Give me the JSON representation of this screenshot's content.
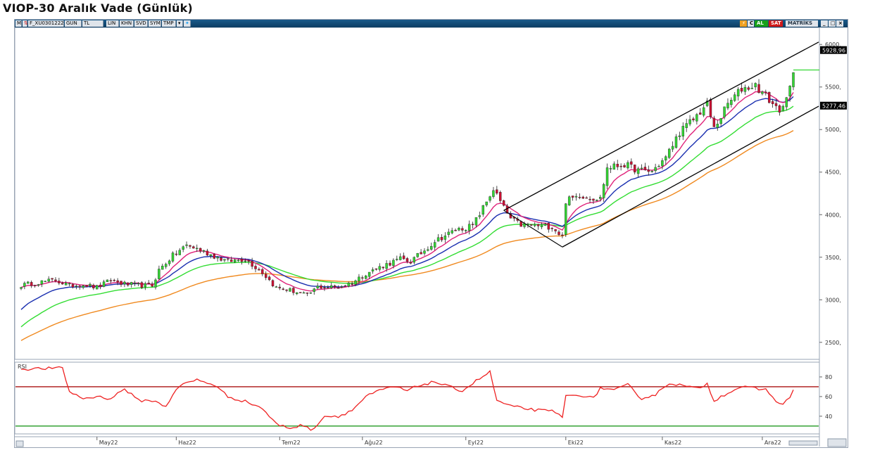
{
  "title": "VIOP-30 Aralık Vade (Günlük)",
  "toolbar": {
    "m_label": "M",
    "symbol": "F_XU0301222",
    "period": "GUN",
    "currency": "TL",
    "btn_lin": "LIN",
    "btn_khn": "KHN",
    "btn_svd": "SVD",
    "btn_sym": "SYM",
    "btn_tmp": "TMP",
    "btn_c": "C",
    "btn_al": "AL",
    "btn_sat": "SAT",
    "brand": "MATRİKS"
  },
  "colors": {
    "up": "#33d633",
    "down": "#cc1133",
    "ema_pink": "#e0227a",
    "ema_blue": "#1a2fb0",
    "ema_green": "#33dd33",
    "ema_orange": "#f08a20",
    "rsi": "#ee2222",
    "rsi_upper": "#aa1111",
    "rsi_lower": "#229922",
    "channel": "#000000"
  },
  "chart_data": {
    "type": "candlestick",
    "ylim": [
      2300,
      6200
    ],
    "yticks": [
      "6000,",
      "5500,",
      "5000,",
      "4500,",
      "4000,",
      "3500,",
      "3000,",
      "2500,"
    ],
    "ytick_values": [
      6000,
      5500,
      5000,
      4500,
      4000,
      3500,
      3000,
      2500
    ],
    "last_price_label": "5928,96",
    "ema_label": "5277,46",
    "last_price": 5700,
    "ema_value": 5277,
    "months": [
      {
        "label": "May22",
        "index": 22
      },
      {
        "label": "Haz22",
        "index": 45
      },
      {
        "label": "Tem22",
        "index": 75
      },
      {
        "label": "Ağu22",
        "index": 99
      },
      {
        "label": "Eyl22",
        "index": 129
      },
      {
        "label": "Eki22",
        "index": 158
      },
      {
        "label": "Kas22",
        "index": 186
      },
      {
        "label": "Ara22",
        "index": 215
      }
    ],
    "close_anchors": [
      [
        0,
        3170
      ],
      [
        5,
        3205
      ],
      [
        10,
        3230
      ],
      [
        14,
        3165
      ],
      [
        18,
        3180
      ],
      [
        22,
        3145
      ],
      [
        26,
        3230
      ],
      [
        30,
        3185
      ],
      [
        34,
        3170
      ],
      [
        38,
        3165
      ],
      [
        40,
        3350
      ],
      [
        44,
        3520
      ],
      [
        48,
        3640
      ],
      [
        51,
        3600
      ],
      [
        55,
        3530
      ],
      [
        60,
        3450
      ],
      [
        65,
        3480
      ],
      [
        70,
        3320
      ],
      [
        74,
        3140
      ],
      [
        77,
        3120
      ],
      [
        80,
        3090
      ],
      [
        83,
        3050
      ],
      [
        86,
        3150
      ],
      [
        92,
        3150
      ],
      [
        96,
        3200
      ],
      [
        100,
        3310
      ],
      [
        105,
        3400
      ],
      [
        110,
        3480
      ],
      [
        113,
        3450
      ],
      [
        117,
        3580
      ],
      [
        120,
        3690
      ],
      [
        126,
        3820
      ],
      [
        131,
        3870
      ],
      [
        134,
        4080
      ],
      [
        137,
        4300
      ],
      [
        140,
        4080
      ],
      [
        142,
        3950
      ],
      [
        145,
        3880
      ],
      [
        150,
        3870
      ],
      [
        154,
        3860
      ],
      [
        157,
        3740
      ],
      [
        158,
        4160
      ],
      [
        162,
        4230
      ],
      [
        165,
        4200
      ],
      [
        168,
        4190
      ],
      [
        170,
        4550
      ],
      [
        175,
        4590
      ],
      [
        179,
        4520
      ],
      [
        183,
        4510
      ],
      [
        187,
        4670
      ],
      [
        191,
        4970
      ],
      [
        195,
        5120
      ],
      [
        199,
        5300
      ],
      [
        201,
        5010
      ],
      [
        205,
        5300
      ],
      [
        209,
        5480
      ],
      [
        213,
        5520
      ],
      [
        216,
        5390
      ],
      [
        219,
        5260
      ],
      [
        221,
        5230
      ],
      [
        223,
        5480
      ],
      [
        224,
        5700
      ]
    ],
    "indicator": {
      "name": "RSI",
      "ylim": [
        22,
        95
      ],
      "levels": [
        70,
        30
      ],
      "yticks": [
        "80",
        "60",
        "40"
      ],
      "ytick_values": [
        80,
        60,
        40
      ]
    },
    "rsi": [
      [
        0,
        88
      ],
      [
        12,
        89
      ],
      [
        14,
        65
      ],
      [
        18,
        58
      ],
      [
        22,
        60
      ],
      [
        26,
        58
      ],
      [
        30,
        68
      ],
      [
        34,
        56
      ],
      [
        38,
        56
      ],
      [
        42,
        50
      ],
      [
        45,
        68
      ],
      [
        48,
        74
      ],
      [
        51,
        77
      ],
      [
        56,
        72
      ],
      [
        60,
        60
      ],
      [
        66,
        54
      ],
      [
        70,
        48
      ],
      [
        74,
        32
      ],
      [
        78,
        28
      ],
      [
        82,
        31
      ],
      [
        84,
        25
      ],
      [
        88,
        40
      ],
      [
        92,
        40
      ],
      [
        96,
        46
      ],
      [
        100,
        60
      ],
      [
        104,
        66
      ],
      [
        108,
        70
      ],
      [
        112,
        66
      ],
      [
        116,
        72
      ],
      [
        120,
        75
      ],
      [
        124,
        70
      ],
      [
        128,
        66
      ],
      [
        132,
        76
      ],
      [
        136,
        85
      ],
      [
        138,
        56
      ],
      [
        142,
        50
      ],
      [
        146,
        48
      ],
      [
        150,
        46
      ],
      [
        154,
        45
      ],
      [
        157,
        40
      ],
      [
        158,
        60
      ],
      [
        162,
        62
      ],
      [
        166,
        58
      ],
      [
        168,
        69
      ],
      [
        172,
        66
      ],
      [
        176,
        72
      ],
      [
        180,
        58
      ],
      [
        184,
        62
      ],
      [
        188,
        74
      ],
      [
        192,
        71
      ],
      [
        196,
        68
      ],
      [
        199,
        73
      ],
      [
        201,
        56
      ],
      [
        205,
        64
      ],
      [
        209,
        70
      ],
      [
        213,
        68
      ],
      [
        216,
        67
      ],
      [
        219,
        56
      ],
      [
        221,
        51
      ],
      [
        223,
        60
      ],
      [
        224,
        66
      ]
    ]
  }
}
